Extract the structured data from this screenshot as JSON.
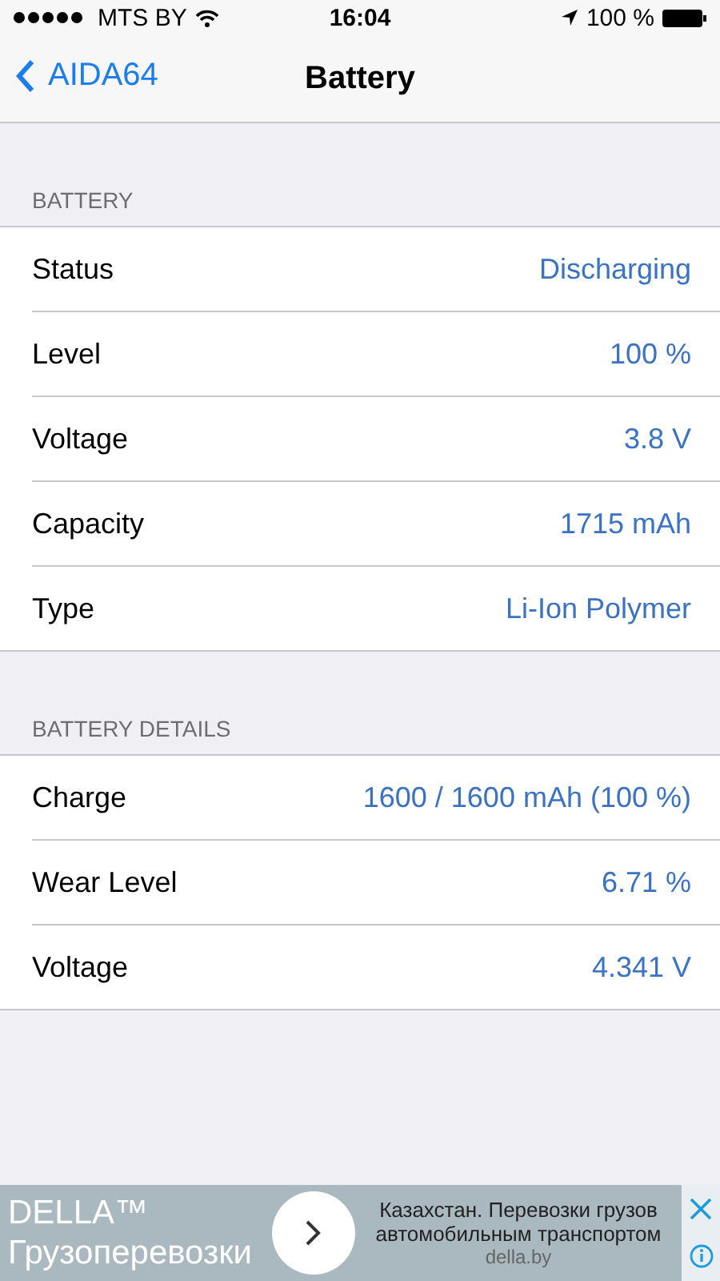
{
  "status_bar": {
    "carrier": "MTS BY",
    "time": "16:04",
    "battery": "100 %"
  },
  "nav": {
    "back": "AIDA64",
    "title": "Battery"
  },
  "sections": [
    {
      "header": "BATTERY",
      "rows": [
        {
          "label": "Status",
          "value": "Discharging"
        },
        {
          "label": "Level",
          "value": "100 %"
        },
        {
          "label": "Voltage",
          "value": "3.8 V"
        },
        {
          "label": "Capacity",
          "value": "1715 mAh"
        },
        {
          "label": "Type",
          "value": "Li-Ion Polymer"
        }
      ]
    },
    {
      "header": "BATTERY DETAILS",
      "rows": [
        {
          "label": "Charge",
          "value": "1600 / 1600 mAh (100 %)"
        },
        {
          "label": "Wear Level",
          "value": "6.71 %"
        },
        {
          "label": "Voltage",
          "value": "4.341 V"
        }
      ]
    }
  ],
  "ad": {
    "brand": "DELLA™",
    "tagline": "Грузоперевозки",
    "text": "Казахстан. Перевозки грузов автомобильным транспортом",
    "domain": "della.by"
  }
}
